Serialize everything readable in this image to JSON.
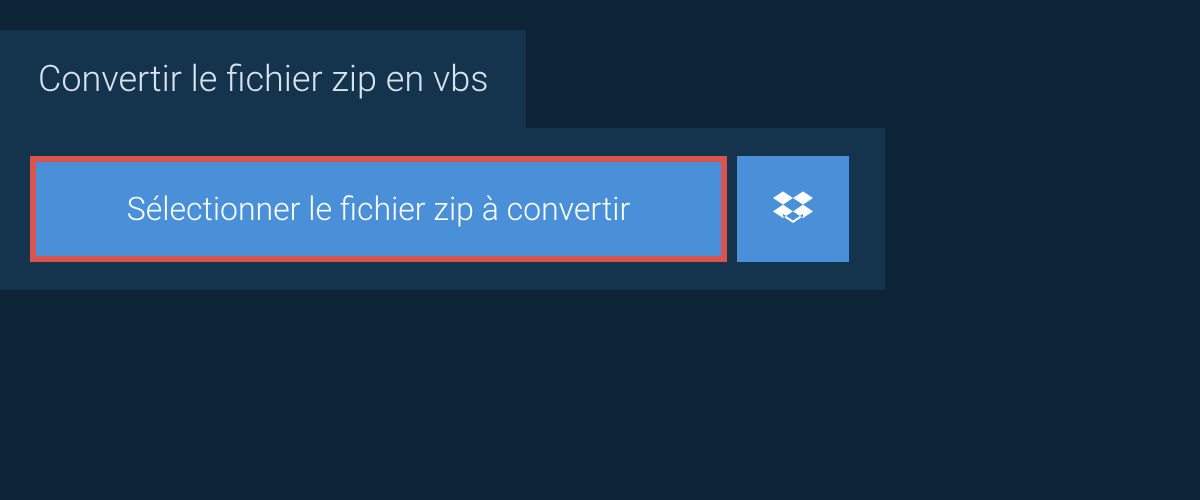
{
  "header": {
    "title": "Convertir le fichier zip en vbs"
  },
  "actions": {
    "select_file_label": "Sélectionner le fichier zip à convertir",
    "dropbox_icon": "dropbox-icon"
  }
}
